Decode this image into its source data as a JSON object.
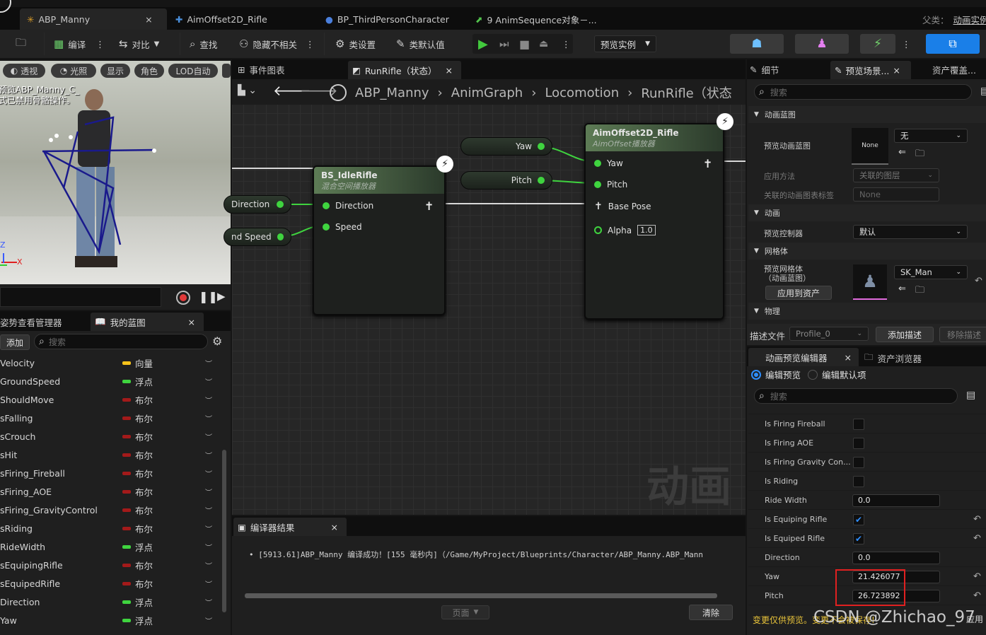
{
  "tabs": [
    {
      "label": "ABP_Manny",
      "close": "×"
    },
    {
      "label": "AimOffset2D_Rifle"
    },
    {
      "label": "BP_ThirdPersonCharacter"
    },
    {
      "label": "9 AnimSequence对象－..."
    }
  ],
  "parent": {
    "label": "父类：",
    "value": "动画实例"
  },
  "toolbar": {
    "compile": "编译",
    "diff": "对比",
    "find": "查找",
    "hide_unrelated": "隐藏不相关",
    "class_settings": "类设置",
    "class_defaults": "类默认值",
    "preview_instance": "预览实例"
  },
  "viewport": {
    "pills": [
      "透视",
      "光照",
      "显示",
      "角色",
      "LOD自动"
    ],
    "overlay_line1": "预览ABP_Manny_C_",
    "overlay_line2": "式已禁用骨骼操作。",
    "axis_z": "Z",
    "axis_x": "X"
  },
  "left_panel": {
    "tab1": "姿势查看管理器",
    "tab2": "我的蓝图",
    "close": "×",
    "add": "添加",
    "search_placeholder": "搜索",
    "variables": [
      {
        "name": "Velocity",
        "type": "向量",
        "color": "#f5c21a"
      },
      {
        "name": "GroundSpeed",
        "type": "浮点",
        "color": "#3fd43f"
      },
      {
        "name": "ShouldMove",
        "type": "布尔",
        "color": "#a31a1a"
      },
      {
        "name": "sFalling",
        "type": "布尔",
        "color": "#a31a1a"
      },
      {
        "name": "sCrouch",
        "type": "布尔",
        "color": "#a31a1a"
      },
      {
        "name": "sHit",
        "type": "布尔",
        "color": "#a31a1a"
      },
      {
        "name": "sFiring_Fireball",
        "type": "布尔",
        "color": "#a31a1a"
      },
      {
        "name": "sFiring_AOE",
        "type": "布尔",
        "color": "#a31a1a"
      },
      {
        "name": "sFiring_GravityControl",
        "type": "布尔",
        "color": "#a31a1a"
      },
      {
        "name": "sRiding",
        "type": "布尔",
        "color": "#a31a1a"
      },
      {
        "name": "RideWidth",
        "type": "浮点",
        "color": "#3fd43f"
      },
      {
        "name": "sEquipingRifle",
        "type": "布尔",
        "color": "#a31a1a"
      },
      {
        "name": "sEquipedRifle",
        "type": "布尔",
        "color": "#a31a1a"
      },
      {
        "name": "Direction",
        "type": "浮点",
        "color": "#3fd43f"
      },
      {
        "name": "Yaw",
        "type": "浮点",
        "color": "#3fd43f"
      }
    ]
  },
  "graph": {
    "tab_event": "事件图表",
    "tab_runrifle": "RunRifle（状态）",
    "close": "×",
    "breadcrumb": [
      "ABP_Manny",
      "AnimGraph",
      "Locomotion",
      "RunRifle（状态"
    ],
    "watermark": "动画",
    "node_blend": {
      "title": "BS_IdleRifle",
      "subtitle": "混合空间播放器",
      "pin1": "Direction",
      "pin2": "Speed"
    },
    "node_aim": {
      "title": "AimOffset2D_Rifle",
      "subtitle": "AimOffset播放器",
      "pin_yaw": "Yaw",
      "pin_pitch": "Pitch",
      "pin_base": "Base Pose",
      "pin_alpha": "Alpha",
      "alpha_value": "1.0"
    },
    "var_direction": "Direction",
    "var_speed": "nd Speed",
    "var_yaw": "Yaw",
    "var_pitch": "Pitch"
  },
  "compiler": {
    "title": "编译器结果",
    "close": "×",
    "message": "[5913.61]ABP_Manny 编译成功！[155 毫秒内]（/Game/MyProject/Blueprints/Character/ABP_Manny.ABP_Mann",
    "page": "页面",
    "clear": "清除"
  },
  "details": {
    "tab_details": "细节",
    "tab_preview": "预览场景...",
    "tab_asset": "资产覆盖...",
    "close": "×",
    "search_placeholder": "搜索",
    "section_anim_bp": "动画蓝图",
    "preview_anim_bp": "预览动画蓝图",
    "none_thumb": "None",
    "none_dd": "无",
    "apply_method": "应用方法",
    "apply_method_value": "关联的图层",
    "linked_tag": "关联的动画图表标签",
    "linked_tag_value": "None",
    "section_anim": "动画",
    "preview_controller": "预览控制器",
    "preview_controller_value": "默认",
    "section_mesh": "网格体",
    "preview_mesh_1": "预览网格体",
    "preview_mesh_2": "（动画蓝图）",
    "mesh_value": "SK_Man",
    "apply_to_asset": "应用到资产",
    "section_physics": "物理",
    "profile_label": "描述文件",
    "profile_value": "Profile_0",
    "add_profile": "添加描述",
    "remove_profile": "移除描述"
  },
  "anim_preview": {
    "tab": "动画预览编辑器",
    "tab2": "资产浏览器",
    "close": "×",
    "radio1": "编辑预览",
    "radio2": "编辑默认项",
    "search_placeholder": "搜索",
    "rows": [
      {
        "label": "Is Firing Fireball",
        "kind": "check",
        "checked": false
      },
      {
        "label": "Is Firing AOE",
        "kind": "check",
        "checked": false
      },
      {
        "label": "Is Firing Gravity Con...",
        "kind": "check",
        "checked": false
      },
      {
        "label": "Is Riding",
        "kind": "check",
        "checked": false
      },
      {
        "label": "Ride Width",
        "kind": "value",
        "value": "0.0"
      },
      {
        "label": "Is Equiping Rifle",
        "kind": "check",
        "checked": true,
        "reset": true
      },
      {
        "label": "Is Equiped Rifle",
        "kind": "check",
        "checked": true,
        "reset": true
      },
      {
        "label": "Direction",
        "kind": "value",
        "value": "0.0"
      },
      {
        "label": "Yaw",
        "kind": "value",
        "value": "21.426077",
        "reset": true
      },
      {
        "label": "Pitch",
        "kind": "value",
        "value": "26.723892",
        "reset": true
      }
    ],
    "footer_note": "变更仅供预览。变更不会被保存!",
    "footer_apply": "应用",
    "watermark": "CSDN @Zhichao_97"
  },
  "colors": {
    "accent": "#2e8eff",
    "float_pin": "#3fd43f",
    "bool": "#a31a1a",
    "vector": "#f5c21a",
    "highlight_box": "#e02020",
    "warning_text": "#e8c33a"
  }
}
